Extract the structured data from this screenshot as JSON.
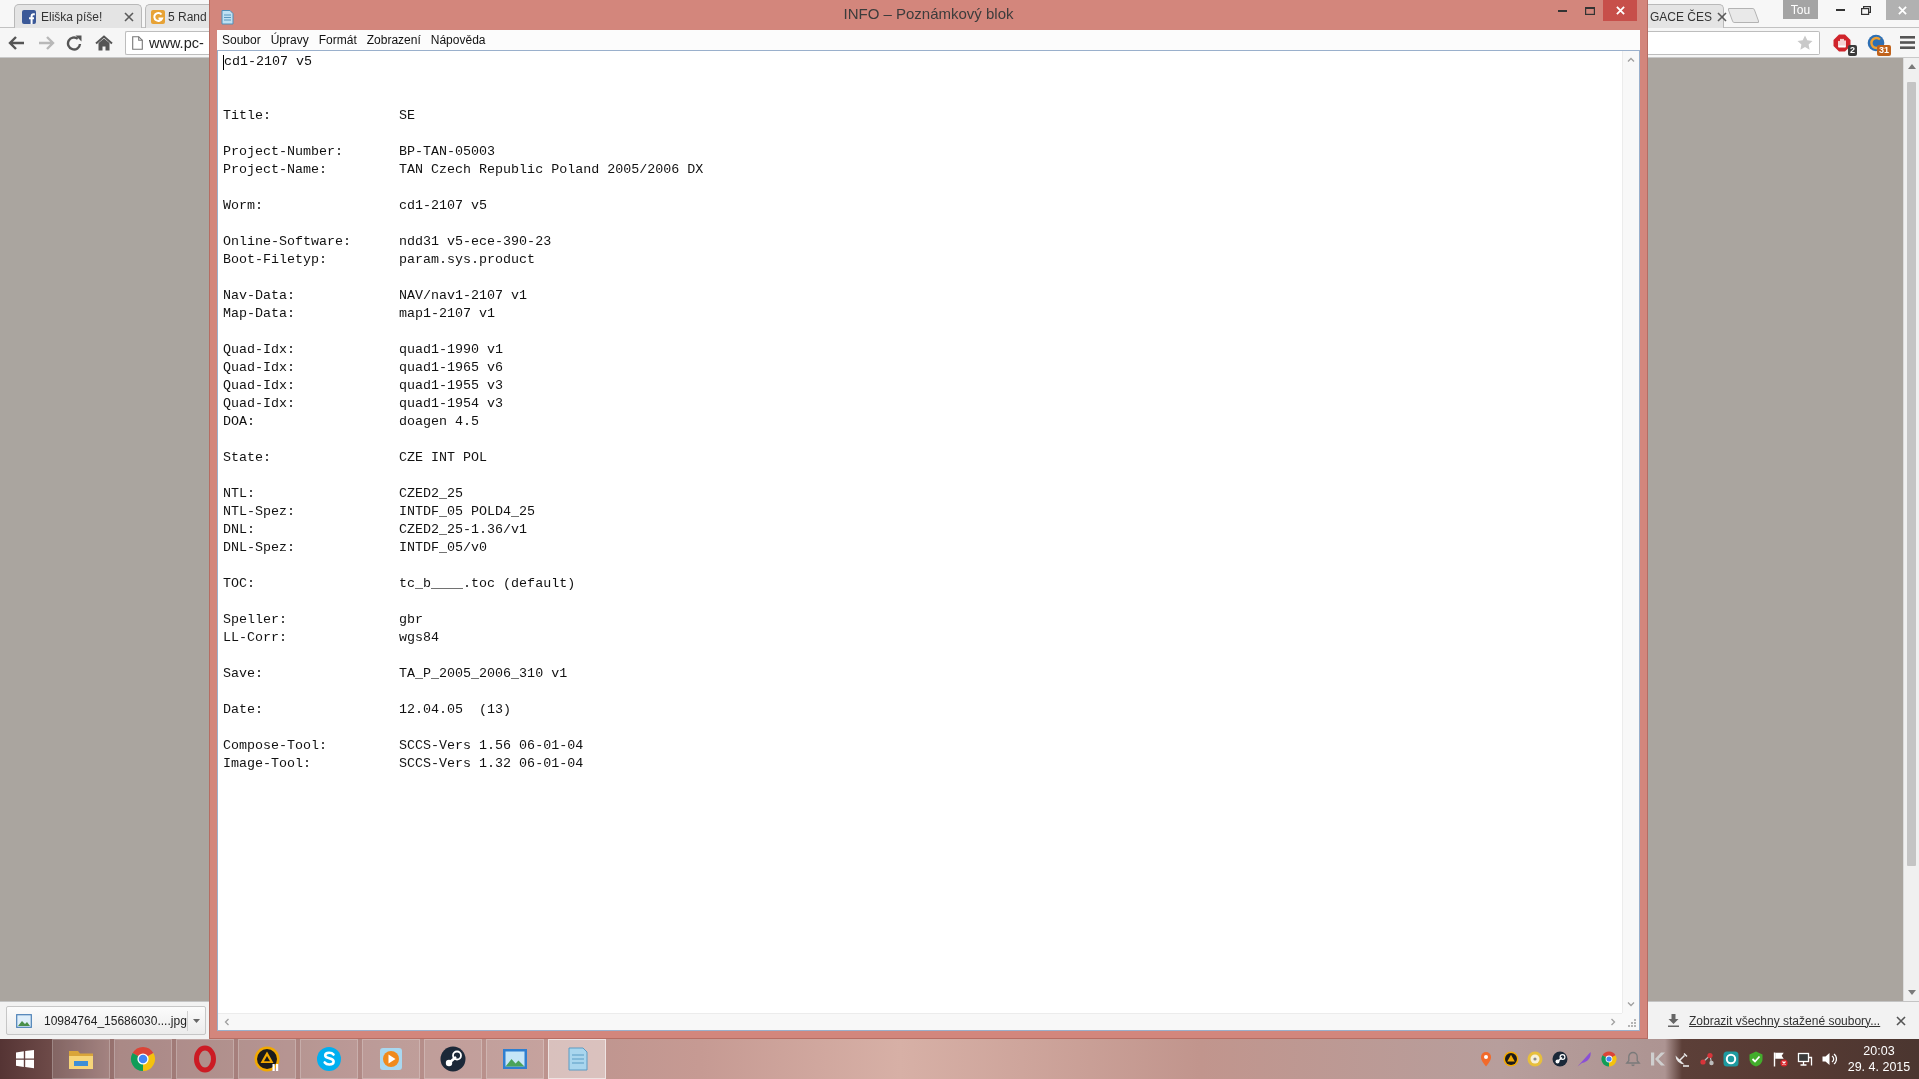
{
  "browser": {
    "tabs": [
      {
        "title": "Eliška píše!",
        "selected": false
      },
      {
        "title": "5 Rand",
        "selected": false
      },
      {
        "title": "GACE ČES",
        "selected": false
      }
    ],
    "profile_button": "Tou",
    "nav_buttons": [
      {
        "disabled": false
      },
      {
        "disabled": true
      },
      {
        "disabled": false
      },
      {
        "disabled": false
      }
    ],
    "address": "www.pc-",
    "extensions": [
      {
        "badge": "2",
        "color": "#3a3a3a"
      },
      {
        "badge": "31",
        "color": "#c0621c"
      }
    ],
    "download_bar": {
      "item": "10984764_15686030....jpg",
      "show_all": "Zobrazit všechny stažené soubory..."
    }
  },
  "notepad": {
    "title": "INFO – Poznámkový blok",
    "menu": [
      "Soubor",
      "Úpravy",
      "Formát",
      "Zobrazení",
      "Nápověda"
    ],
    "first_line": "cd1-2107 v5",
    "blocks": [
      [
        {
          "label": "Title:",
          "value": "SE"
        }
      ],
      [
        {
          "label": "Project-Number:",
          "value": "BP-TAN-05003"
        },
        {
          "label": "Project-Name:",
          "value": "TAN Czech Republic Poland 2005/2006 DX"
        }
      ],
      [
        {
          "label": "Worm:",
          "value": "cd1-2107 v5"
        }
      ],
      [
        {
          "label": "Online-Software:",
          "value": "ndd31 v5-ece-390-23"
        },
        {
          "label": "Boot-Filetyp:",
          "value": "param.sys.product"
        }
      ],
      [
        {
          "label": "Nav-Data:",
          "value": "NAV/nav1-2107 v1"
        },
        {
          "label": "Map-Data:",
          "value": "map1-2107 v1"
        }
      ],
      [
        {
          "label": "Quad-Idx:",
          "value": "quad1-1990 v1"
        },
        {
          "label": "Quad-Idx:",
          "value": "quad1-1965 v6"
        },
        {
          "label": "Quad-Idx:",
          "value": "quad1-1955 v3"
        },
        {
          "label": "Quad-Idx:",
          "value": "quad1-1954 v3"
        },
        {
          "label": "DOA:",
          "value": "doagen 4.5"
        }
      ],
      [
        {
          "label": "State:",
          "value": "CZE INT POL"
        }
      ],
      [
        {
          "label": "NTL:",
          "value": "CZED2_25"
        },
        {
          "label": "NTL-Spez:",
          "value": "INTDF_05 POLD4_25"
        },
        {
          "label": "DNL:",
          "value": "CZED2_25-1.36/v1"
        },
        {
          "label": "DNL-Spez:",
          "value": "INTDF_05/v0"
        }
      ],
      [
        {
          "label": "TOC:",
          "value": "tc_b____.toc (default)"
        }
      ],
      [
        {
          "label": "Speller:",
          "value": "gbr"
        },
        {
          "label": "LL-Corr:",
          "value": "wgs84"
        }
      ],
      [
        {
          "label": "Save:",
          "value": "TA_P_2005_2006_310 v1"
        }
      ],
      [
        {
          "label": "Date:",
          "value": "12.04.05  (13)"
        }
      ],
      [
        {
          "label": "Compose-Tool:",
          "value": "SCCS-Vers 1.56 06-01-04"
        },
        {
          "label": "Image-Tool:",
          "value": "SCCS-Vers 1.32 06-01-04"
        }
      ]
    ]
  },
  "taskbar": {
    "apps": [
      {
        "active": false
      },
      {
        "active": false
      },
      {
        "active": false
      },
      {
        "active": false
      },
      {
        "active": false
      },
      {
        "active": false
      },
      {
        "active": false
      },
      {
        "active": false
      },
      {
        "active": true
      }
    ],
    "clock": {
      "time": "20:03",
      "date": "29. 4. 2015"
    }
  }
}
